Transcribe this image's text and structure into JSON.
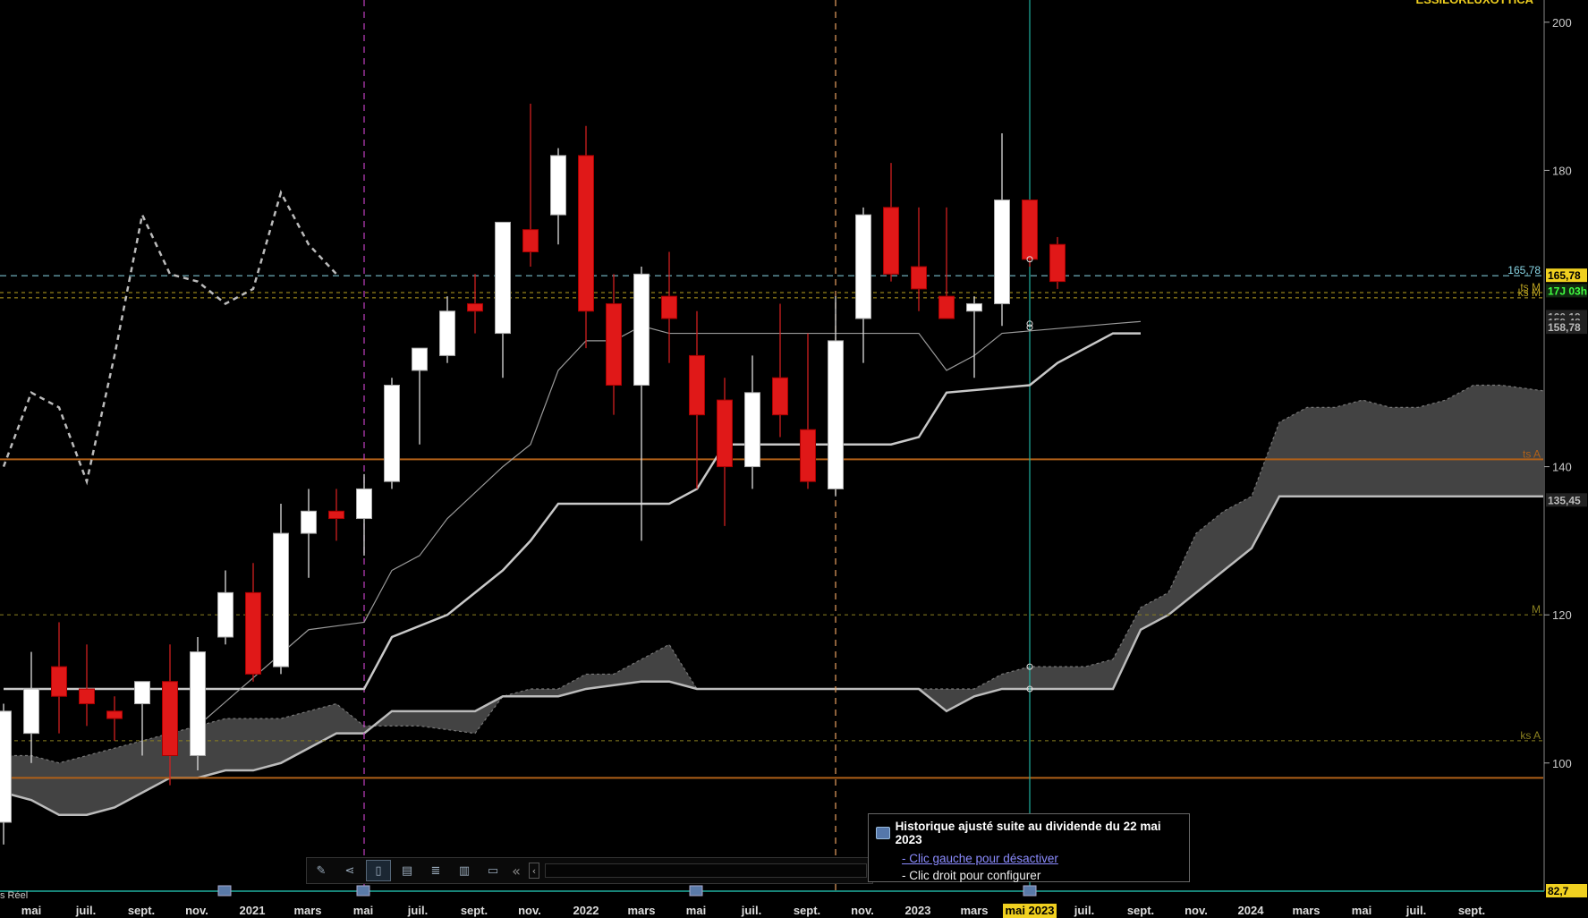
{
  "chart_data": {
    "type": "candlestick",
    "title": "ESSILORLUXOTTICA",
    "interval": "monthly",
    "y_axis": {
      "min": 82.7,
      "max": 203,
      "ticks": [
        100,
        120,
        140,
        180,
        200
      ]
    },
    "x_axis": {
      "labels": [
        "mai",
        "juil.",
        "sept.",
        "nov.",
        "2021",
        "mars",
        "mai",
        "juil.",
        "sept.",
        "nov.",
        "2022",
        "mars",
        "mai",
        "juil.",
        "sept.",
        "nov.",
        "2023",
        "mars",
        "mai 2023",
        "juil.",
        "sept.",
        "nov.",
        "2024",
        "mars",
        "mai",
        "juil.",
        "sept."
      ],
      "highlighted_label": "mai 2023"
    },
    "candles": [
      {
        "o": 92,
        "h": 108,
        "l": 89,
        "c": 107
      },
      {
        "o": 104,
        "h": 115,
        "l": 100,
        "c": 110
      },
      {
        "o": 113,
        "h": 119,
        "l": 104,
        "c": 109
      },
      {
        "o": 110,
        "h": 116,
        "l": 105,
        "c": 108
      },
      {
        "o": 107,
        "h": 109,
        "l": 103,
        "c": 106
      },
      {
        "o": 108,
        "h": 111,
        "l": 101,
        "c": 111
      },
      {
        "o": 111,
        "h": 116,
        "l": 97,
        "c": 101
      },
      {
        "o": 101,
        "h": 117,
        "l": 99,
        "c": 115
      },
      {
        "o": 117,
        "h": 126,
        "l": 116,
        "c": 123
      },
      {
        "o": 123,
        "h": 127,
        "l": 111,
        "c": 112
      },
      {
        "o": 113,
        "h": 135,
        "l": 112,
        "c": 131
      },
      {
        "o": 131,
        "h": 137,
        "l": 125,
        "c": 134
      },
      {
        "o": 134,
        "h": 137,
        "l": 130,
        "c": 133
      },
      {
        "o": 133,
        "h": 139,
        "l": 128,
        "c": 137
      },
      {
        "o": 138,
        "h": 152,
        "l": 137,
        "c": 151
      },
      {
        "o": 153,
        "h": 156,
        "l": 143,
        "c": 156
      },
      {
        "o": 155,
        "h": 163,
        "l": 154,
        "c": 161
      },
      {
        "o": 162,
        "h": 166,
        "l": 158,
        "c": 161
      },
      {
        "o": 158,
        "h": 166,
        "l": 152,
        "c": 173
      },
      {
        "o": 172,
        "h": 189,
        "l": 167,
        "c": 169
      },
      {
        "o": 174,
        "h": 183,
        "l": 170,
        "c": 182
      },
      {
        "o": 182,
        "h": 186,
        "l": 156,
        "c": 161
      },
      {
        "o": 162,
        "h": 166,
        "l": 147,
        "c": 151
      },
      {
        "o": 151,
        "h": 167,
        "l": 130,
        "c": 166
      },
      {
        "o": 163,
        "h": 169,
        "l": 154,
        "c": 160
      },
      {
        "o": 155,
        "h": 161,
        "l": 137,
        "c": 147
      },
      {
        "o": 149,
        "h": 152,
        "l": 132,
        "c": 140
      },
      {
        "o": 140,
        "h": 155,
        "l": 137,
        "c": 150
      },
      {
        "o": 152,
        "h": 162,
        "l": 144,
        "c": 147
      },
      {
        "o": 145,
        "h": 158,
        "l": 137,
        "c": 138
      },
      {
        "o": 137,
        "h": 163,
        "l": 136,
        "c": 157
      },
      {
        "o": 160,
        "h": 175,
        "l": 154,
        "c": 174
      },
      {
        "o": 175,
        "h": 181,
        "l": 165,
        "c": 166
      },
      {
        "o": 167,
        "h": 175,
        "l": 161,
        "c": 164
      },
      {
        "o": 163,
        "h": 175,
        "l": 160,
        "c": 160
      },
      {
        "o": 161,
        "h": 163,
        "l": 152,
        "c": 162
      },
      {
        "o": 162,
        "h": 185,
        "l": 159,
        "c": 176
      },
      {
        "o": 176,
        "h": 176,
        "l": 167,
        "c": 168
      },
      {
        "o": 170,
        "h": 171,
        "l": 164,
        "c": 165
      }
    ],
    "kijun": [
      [
        0,
        110
      ],
      [
        13,
        110
      ],
      [
        14,
        117
      ],
      [
        16,
        120
      ],
      [
        17,
        123
      ],
      [
        18,
        126
      ],
      [
        19,
        130
      ],
      [
        20,
        135
      ],
      [
        24,
        135
      ],
      [
        25,
        137
      ],
      [
        26,
        143
      ],
      [
        32,
        143
      ],
      [
        33,
        144
      ],
      [
        34,
        150
      ],
      [
        37,
        151
      ],
      [
        38,
        154
      ],
      [
        40,
        158
      ],
      [
        41,
        158
      ]
    ],
    "tenkan": [
      [
        7,
        105
      ],
      [
        11,
        118
      ],
      [
        13,
        119
      ],
      [
        14,
        126
      ],
      [
        15,
        128
      ],
      [
        16,
        133
      ],
      [
        18,
        140
      ],
      [
        19,
        143
      ],
      [
        20,
        153
      ],
      [
        21,
        157
      ],
      [
        22,
        157
      ],
      [
        23,
        159
      ],
      [
        24,
        158
      ],
      [
        28,
        158
      ],
      [
        33,
        158
      ],
      [
        34,
        153
      ],
      [
        35,
        155
      ],
      [
        36,
        158
      ],
      [
        40,
        159.3
      ],
      [
        41,
        159.6
      ]
    ],
    "chikou": [
      [
        0,
        140
      ],
      [
        1,
        150
      ],
      [
        2,
        148
      ],
      [
        3,
        138
      ],
      [
        4,
        155
      ],
      [
        5,
        174
      ],
      [
        6,
        166
      ],
      [
        7,
        165
      ],
      [
        8,
        162
      ],
      [
        9,
        164
      ],
      [
        10,
        177
      ],
      [
        11,
        170
      ],
      [
        12,
        166
      ]
    ],
    "cloud": {
      "ssa": [
        [
          0,
          101
        ],
        [
          1,
          101
        ],
        [
          2,
          100
        ],
        [
          3,
          101
        ],
        [
          4,
          102
        ],
        [
          6,
          104
        ],
        [
          7,
          105
        ],
        [
          8,
          106
        ],
        [
          10,
          106
        ],
        [
          12,
          108
        ],
        [
          13,
          105
        ],
        [
          15,
          105
        ],
        [
          17,
          104
        ],
        [
          18,
          109
        ],
        [
          19,
          110
        ],
        [
          20,
          110
        ],
        [
          21,
          112
        ],
        [
          22,
          112
        ],
        [
          23,
          114
        ],
        [
          24,
          116
        ],
        [
          25,
          110
        ],
        [
          26,
          110
        ],
        [
          35,
          110
        ],
        [
          36,
          112
        ],
        [
          37,
          113
        ],
        [
          38,
          113
        ],
        [
          39,
          113
        ],
        [
          40,
          114
        ],
        [
          41,
          121
        ],
        [
          42,
          123
        ],
        [
          43,
          131
        ],
        [
          44,
          134
        ],
        [
          45,
          136
        ],
        [
          46,
          146
        ],
        [
          47,
          148
        ],
        [
          48,
          148
        ],
        [
          49,
          149
        ],
        [
          50,
          148
        ],
        [
          51,
          148
        ],
        [
          52,
          149
        ],
        [
          53,
          151
        ],
        [
          54,
          151
        ],
        [
          56,
          150
        ]
      ],
      "ssb": [
        [
          0,
          96
        ],
        [
          1,
          95
        ],
        [
          2,
          93
        ],
        [
          3,
          93
        ],
        [
          4,
          94
        ],
        [
          5,
          96
        ],
        [
          6,
          98
        ],
        [
          7,
          98
        ],
        [
          8,
          99
        ],
        [
          9,
          99
        ],
        [
          10,
          100
        ],
        [
          12,
          104
        ],
        [
          13,
          104
        ],
        [
          14,
          107
        ],
        [
          16,
          107
        ],
        [
          17,
          107
        ],
        [
          18,
          109
        ],
        [
          20,
          109
        ],
        [
          21,
          110
        ],
        [
          23,
          111
        ],
        [
          24,
          111
        ],
        [
          25,
          110
        ],
        [
          33,
          110
        ],
        [
          34,
          107
        ],
        [
          35,
          109
        ],
        [
          36,
          110
        ],
        [
          40,
          110
        ],
        [
          41,
          118
        ],
        [
          42,
          120
        ],
        [
          43,
          123
        ],
        [
          44,
          126
        ],
        [
          45,
          129
        ],
        [
          46,
          136
        ],
        [
          56,
          136
        ]
      ]
    },
    "horizontal_lines": [
      {
        "value": 165.78,
        "label": "165,78",
        "style": "dashed",
        "color": "#8ad8e8"
      },
      {
        "value": 163.5,
        "label": "ts M",
        "style": "dotted",
        "color": "#b8a020"
      },
      {
        "value": 162.8,
        "label": "ks M",
        "style": "dotted",
        "color": "#b8a020"
      },
      {
        "value": 141,
        "label": "ts A",
        "style": "solid",
        "color": "#b06018"
      },
      {
        "value": 120,
        "label": "M",
        "style": "dotted",
        "color": "#8a8020"
      },
      {
        "value": 103,
        "label": "ks A",
        "style": "dotted",
        "color": "#8a8020"
      },
      {
        "value": 98,
        "label": "",
        "style": "solid",
        "color": "#b06018"
      }
    ],
    "price_labels": [
      {
        "value": 165.78,
        "text": "165,78",
        "bg": "#f0d020",
        "fg": "#000"
      },
      {
        "value": 163.7,
        "text": "17J 03h",
        "bg": "#102a10",
        "fg": "#40ff40"
      },
      {
        "value": 160.19,
        "text": "160,19",
        "bg": "#222",
        "fg": "#aaa"
      },
      {
        "value": 159.48,
        "text": "159,48",
        "bg": "#222",
        "fg": "#aaa"
      },
      {
        "value": 158.78,
        "text": "158,78",
        "bg": "#222",
        "fg": "#bbb"
      },
      {
        "value": 135.45,
        "text": "135,45",
        "bg": "#222",
        "fg": "#bbb"
      },
      {
        "value": 82.7,
        "text": "82,7",
        "bg": "#f0d020",
        "fg": "#000"
      }
    ],
    "vertical_markers": [
      {
        "x": 13,
        "color": "#c040c0",
        "style": "dashed"
      },
      {
        "x": 30,
        "color": "#e8a060",
        "style": "dashed"
      },
      {
        "x": 37,
        "color": "#20b0a0",
        "style": "solid"
      }
    ],
    "bottom_left_label": "s Réel"
  },
  "toolbar": {
    "scroll_left": "«",
    "scroll_prev": "‹"
  },
  "tooltip": {
    "title": "Historique ajusté suite au dividende du 22 mai 2023",
    "line1": "- Clic gauche pour désactiver",
    "line2": "- Clic droit pour configurer"
  }
}
